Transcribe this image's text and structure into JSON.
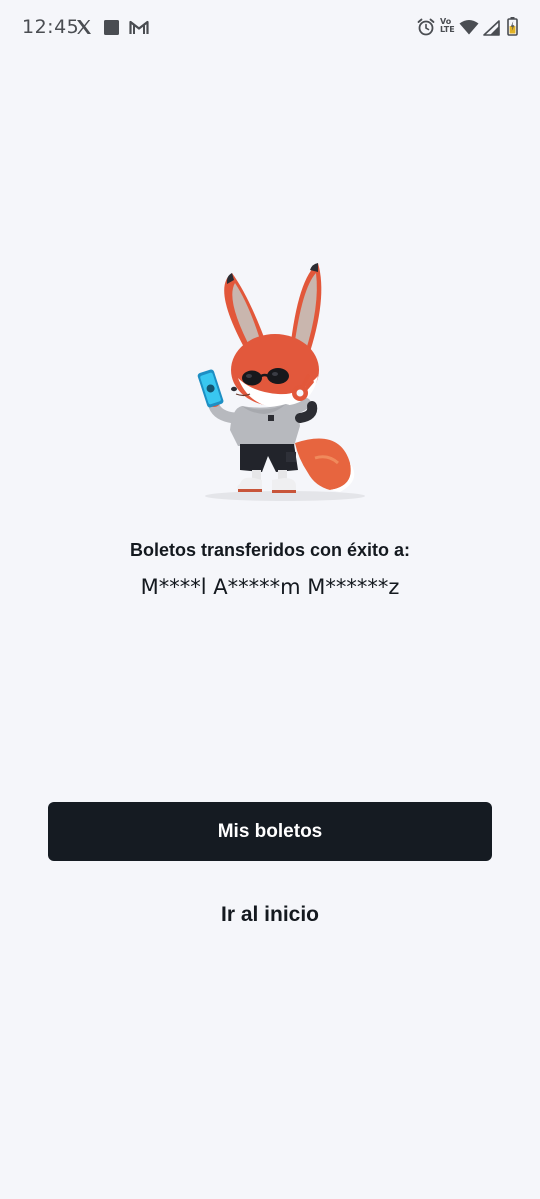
{
  "status_bar": {
    "time": "12:45",
    "icons": [
      "x-logo-icon",
      "stop-square-icon",
      "gmail-icon",
      "alarm-icon",
      "volte-icon",
      "wifi-icon",
      "signal-icon",
      "battery-icon"
    ],
    "volte_text": "Vo LTE"
  },
  "illustration": {
    "name": "fox-mascot-with-phone"
  },
  "confirmation": {
    "message": "Boletos transferidos con éxito a:",
    "recipient": "M****l A*****m M******z"
  },
  "actions": {
    "primary_label": "Mis boletos",
    "secondary_label": "Ir al inicio"
  },
  "colors": {
    "background": "#f5f6fa",
    "primary_button": "#151b22",
    "text": "#14191f"
  }
}
